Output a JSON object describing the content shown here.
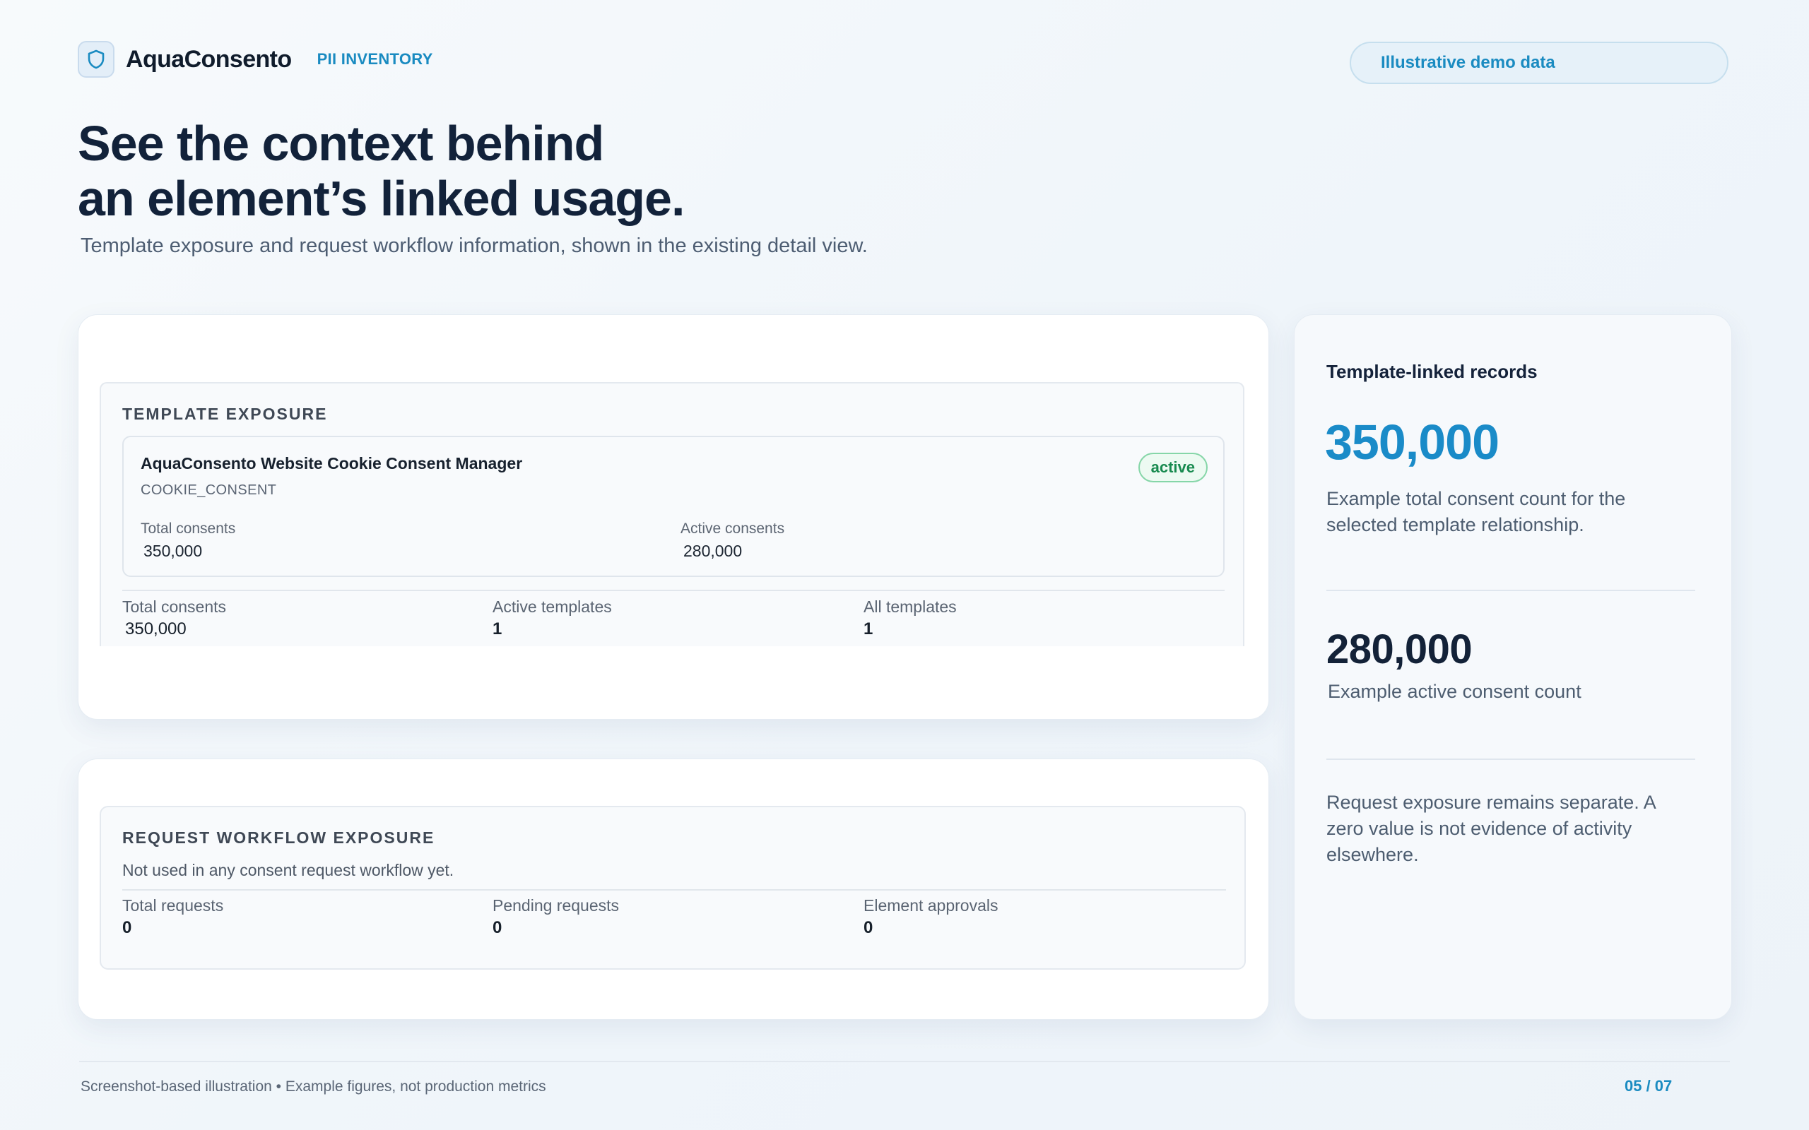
{
  "brand": {
    "name": "AquaConsento",
    "tag": "PII INVENTORY",
    "icon": "shield-icon"
  },
  "demo_badge": "Illustrative demo data",
  "hero": {
    "title_line1": "See the context behind",
    "title_line2": "an element’s linked usage.",
    "subtitle": "Template exposure and request workflow information, shown in the existing detail view."
  },
  "template_exposure": {
    "section_label": "TEMPLATE EXPOSURE",
    "template": {
      "name": "AquaConsento Website Cookie Consent Manager",
      "code": "COOKIE_CONSENT",
      "status": "active",
      "total_consents_label": "Total consents",
      "total_consents_value": "350,000",
      "active_consents_label": "Active consents",
      "active_consents_value": "280,000"
    },
    "summary": [
      {
        "label": "Total consents",
        "value": "350,000"
      },
      {
        "label": "Active templates",
        "value": "1"
      },
      {
        "label": "All templates",
        "value": "1"
      }
    ]
  },
  "request_exposure": {
    "section_label": "REQUEST WORKFLOW EXPOSURE",
    "message": "Not used in any consent request workflow yet.",
    "summary": [
      {
        "label": "Total requests",
        "value": "0"
      },
      {
        "label": "Pending requests",
        "value": "0"
      },
      {
        "label": "Element approvals",
        "value": "0"
      }
    ]
  },
  "side_panel": {
    "title": "Template-linked records",
    "total_value": "350,000",
    "total_desc": "Example total consent count for the selected template relationship.",
    "active_value": "280,000",
    "active_desc": "Example active consent count",
    "note": "Request exposure remains separate. A zero value is not evidence of activity elsewhere."
  },
  "footer": {
    "caption": "Screenshot-based illustration • Example figures, not production metrics",
    "page": "05 / 07"
  },
  "colors": {
    "accent": "#1a8bc1",
    "title": "#12223a",
    "active_green": "#188a4f"
  }
}
